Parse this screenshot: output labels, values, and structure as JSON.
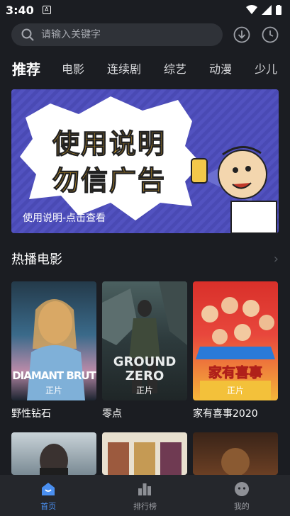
{
  "status": {
    "time": "3:40",
    "notif": "A"
  },
  "search": {
    "placeholder": "请输入关键字"
  },
  "categories": [
    "推荐",
    "电影",
    "连续剧",
    "综艺",
    "动漫",
    "少儿"
  ],
  "banner": {
    "line1": "使用说明",
    "line2": "勿信广告",
    "caption": "使用说明-点击查看"
  },
  "section": {
    "title": "热播电影",
    "more": "›"
  },
  "movies": [
    {
      "title": "野性钻石",
      "badge": "正片",
      "poster_text": "DIAMANT BRUT"
    },
    {
      "title": "零点",
      "badge": "正片",
      "poster_text_1": "GROUND",
      "poster_text_2": "ZERO"
    },
    {
      "title": "家有喜事2020",
      "badge": "正片",
      "poster_text": "家有喜事"
    }
  ],
  "tabs": [
    {
      "label": "首页",
      "icon": "home-icon",
      "active": true
    },
    {
      "label": "排行榜",
      "icon": "ranking-icon",
      "active": false
    },
    {
      "label": "我的",
      "icon": "profile-icon",
      "active": false
    }
  ],
  "colors": {
    "accent": "#4a8ff0",
    "background": "#1b1d22",
    "tabbar": "#25272c",
    "search": "#2f3238"
  }
}
